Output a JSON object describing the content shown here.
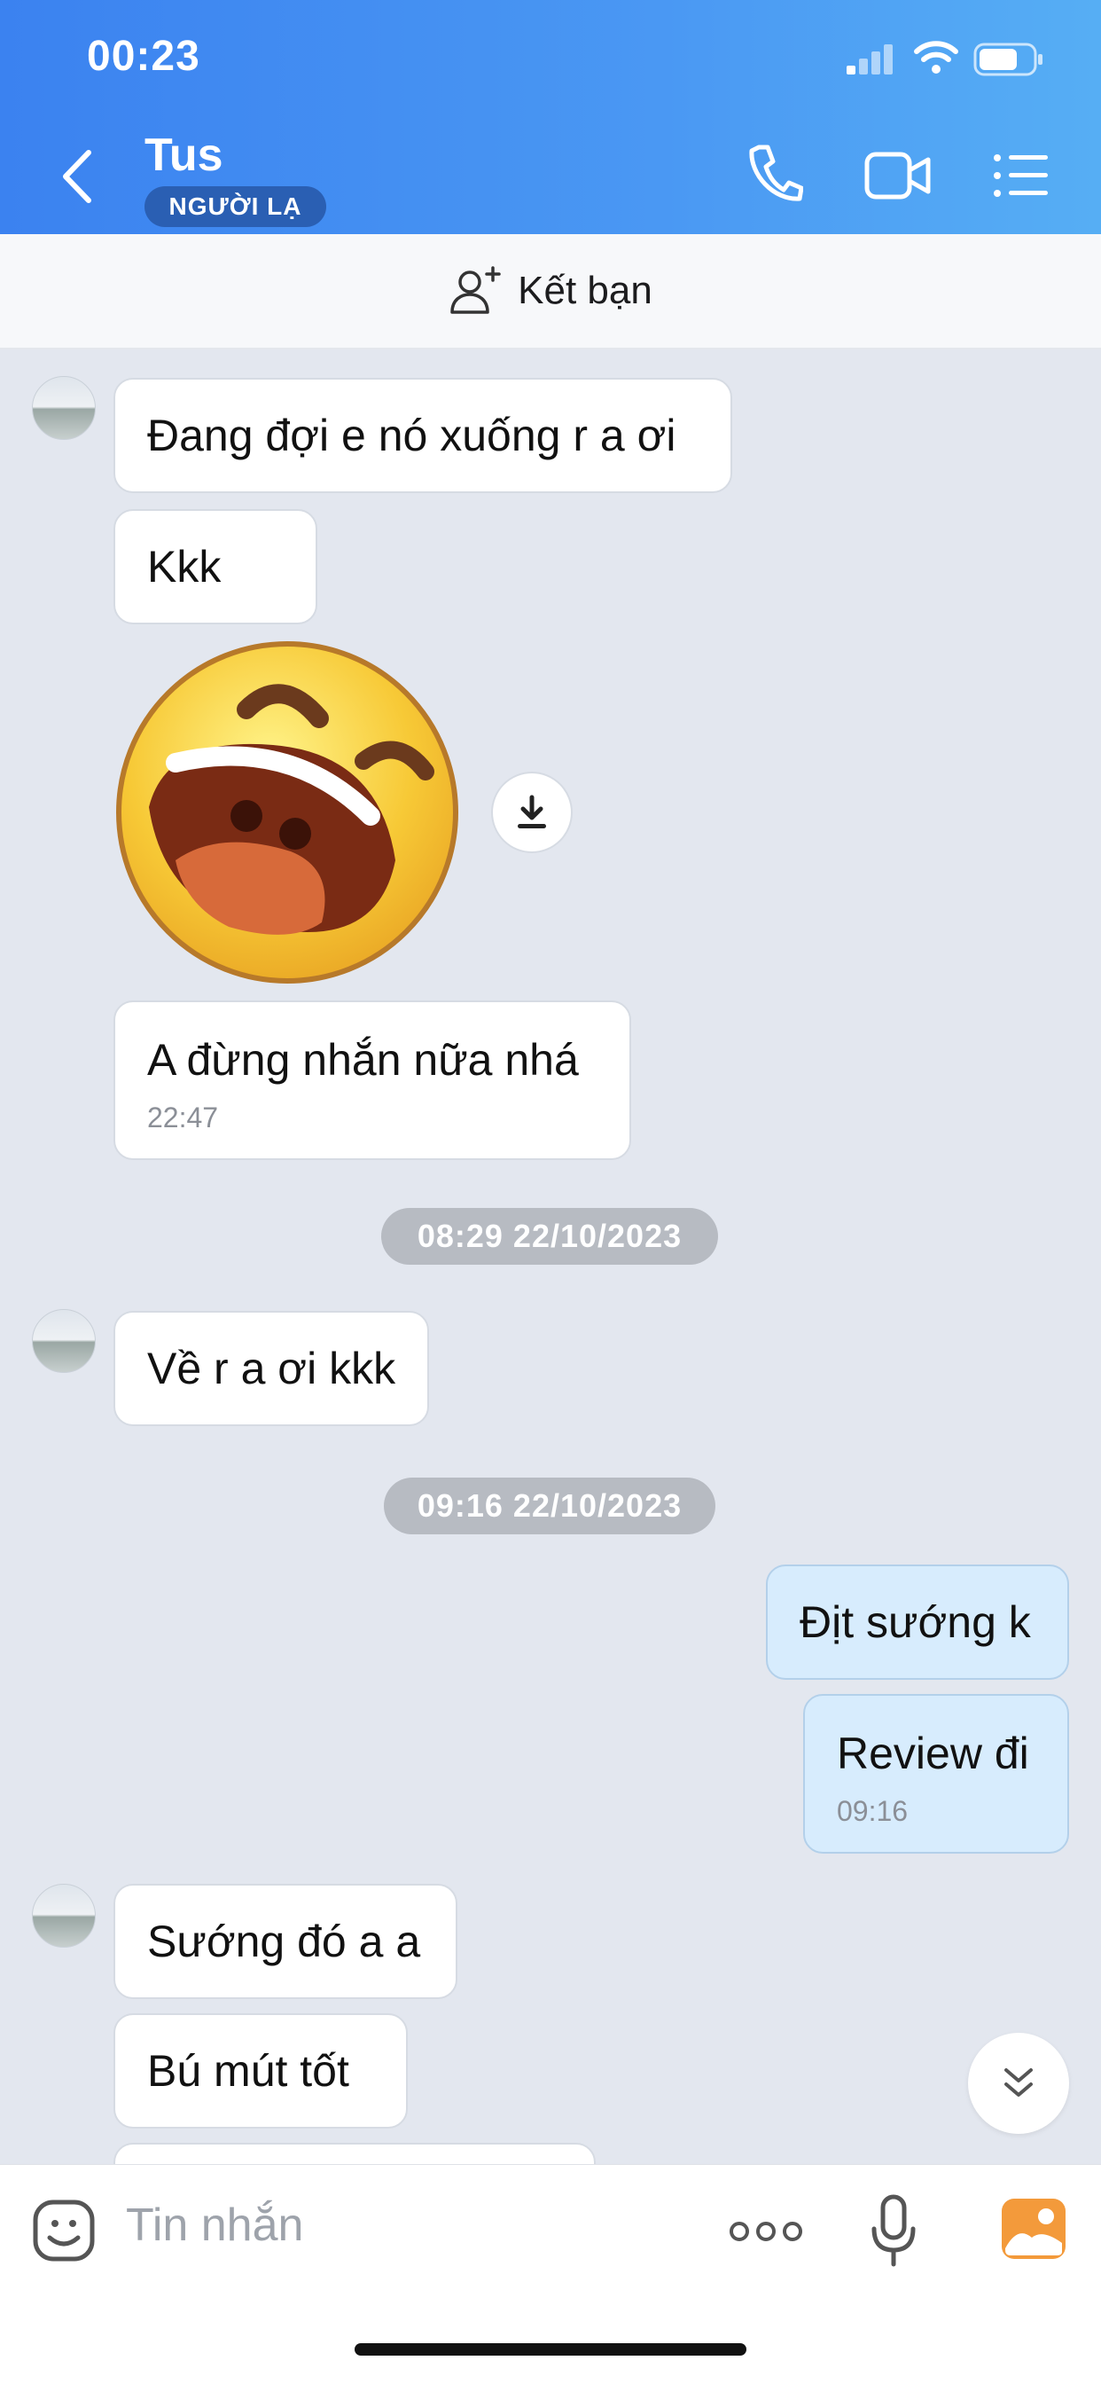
{
  "status_bar": {
    "time": "00:23"
  },
  "header": {
    "contact_name": "Tus",
    "badge": "NGƯỜI LẠ",
    "icons": [
      "back-icon",
      "phone-icon",
      "video-icon",
      "list-icon"
    ]
  },
  "add_friend": {
    "label": "Kết bạn",
    "icon": "add-user-icon"
  },
  "messages": [
    {
      "side": "left",
      "text": "Đang đợi e nó xuống r a ơi"
    },
    {
      "side": "left",
      "text": "Kkk"
    },
    {
      "side": "left",
      "type": "sticker",
      "sticker": "laughing-face"
    },
    {
      "side": "left",
      "text": "A đừng nhắn nữa nhá",
      "time": "22:47"
    },
    {
      "type": "date",
      "text": "08:29 22/10/2023"
    },
    {
      "side": "left",
      "text": "Về r a ơi kkk"
    },
    {
      "type": "date",
      "text": "09:16 22/10/2023"
    },
    {
      "side": "right",
      "text": "Địt sướng k"
    },
    {
      "side": "right",
      "text": "Review đi",
      "time": "09:16"
    },
    {
      "side": "left",
      "text": "Sướng đó a a"
    },
    {
      "side": "left",
      "text": "Bú mút tốt"
    }
  ],
  "composer": {
    "placeholder": "Tin nhắn",
    "icons": [
      "sticker-icon",
      "more-icon",
      "microphone-icon",
      "image-icon"
    ]
  }
}
